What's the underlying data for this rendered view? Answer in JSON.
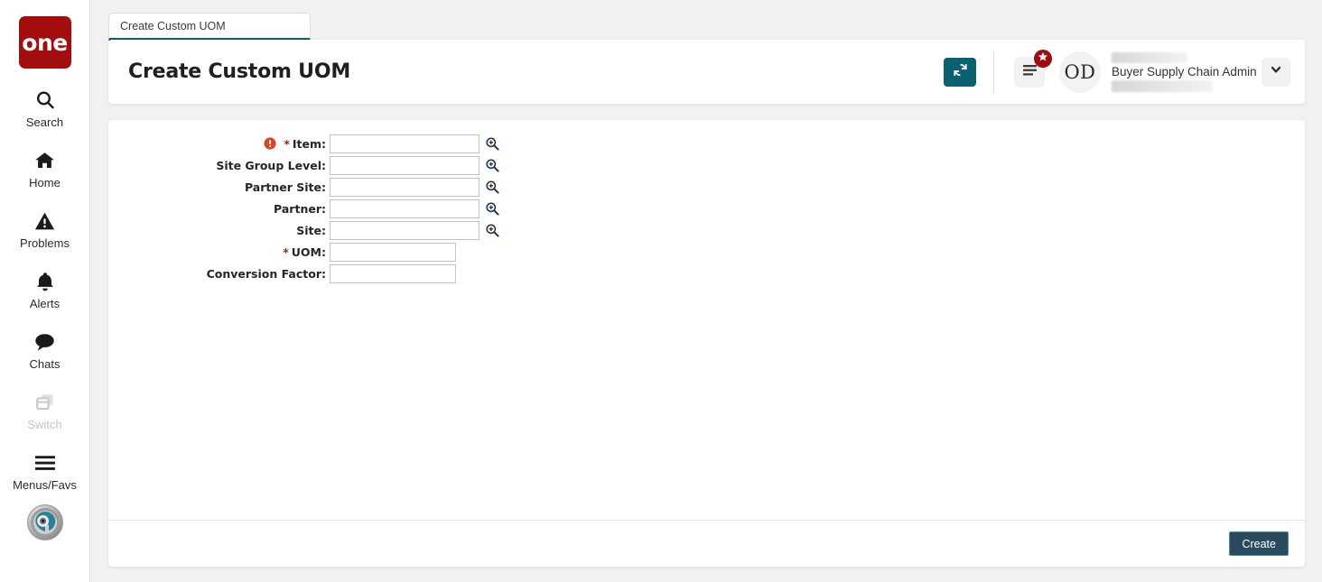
{
  "brand": {
    "logo_text": "one",
    "logo_color": "#a40d0d"
  },
  "theme": {
    "accent_teal": "#0b6071",
    "badge_red": "#9c0d12",
    "required_star": "#8a2b14",
    "error_icon": "#d9452c",
    "create_button_bg": "#2a4a60",
    "create_button_border": "#4d8ba3",
    "page_bg": "#f1f1f1"
  },
  "sidebar": {
    "items": [
      {
        "label": "Search",
        "icon": "search-icon",
        "disabled": false
      },
      {
        "label": "Home",
        "icon": "home-icon",
        "disabled": false
      },
      {
        "label": "Problems",
        "icon": "problems-icon",
        "disabled": false
      },
      {
        "label": "Alerts",
        "icon": "alerts-bell-icon",
        "disabled": false
      },
      {
        "label": "Chats",
        "icon": "chats-icon",
        "disabled": false
      },
      {
        "label": "Switch",
        "icon": "switch-icon",
        "disabled": true
      },
      {
        "label": "Menus/Favs",
        "icon": "hamburger-icon",
        "disabled": false
      }
    ],
    "agent_avatar_icon": "assistant-avatar-icon"
  },
  "tabs": [
    {
      "label": "Create Custom UOM",
      "active": true
    }
  ],
  "header": {
    "title": "Create Custom UOM",
    "refresh_icon": "refresh-icon",
    "favorites_icon": "hamburger-icon",
    "favorites_badge_icon": "star-icon",
    "avatar_initials": "OD",
    "user_role": "Buyer Supply Chain Admin",
    "user_name_redacted": true,
    "user_org_redacted": true,
    "caret_icon": "chevron-down-icon"
  },
  "form": {
    "fields": [
      {
        "label": "Item",
        "required": true,
        "has_error": true,
        "value": "",
        "placeholder": "",
        "type": "lookup",
        "lookup_icon": "magnifier-plus-icon"
      },
      {
        "label": "Site Group Level",
        "required": false,
        "has_error": false,
        "value": "",
        "placeholder": "",
        "type": "lookup",
        "lookup_icon": "magnifier-plus-icon"
      },
      {
        "label": "Partner Site",
        "required": false,
        "has_error": false,
        "value": "",
        "placeholder": "",
        "type": "lookup",
        "lookup_icon": "magnifier-plus-icon"
      },
      {
        "label": "Partner",
        "required": false,
        "has_error": false,
        "value": "",
        "placeholder": "",
        "type": "lookup",
        "lookup_icon": "magnifier-plus-icon"
      },
      {
        "label": "Site",
        "required": false,
        "has_error": false,
        "value": "",
        "placeholder": "",
        "type": "lookup",
        "lookup_icon": "magnifier-plus-icon"
      },
      {
        "label": "UOM",
        "required": true,
        "has_error": false,
        "value": "",
        "placeholder": "",
        "type": "plain",
        "lookup_icon": ""
      },
      {
        "label": "Conversion Factor",
        "required": false,
        "has_error": false,
        "value": "",
        "placeholder": "",
        "type": "plain",
        "lookup_icon": ""
      }
    ]
  },
  "footer": {
    "create_label": "Create"
  }
}
